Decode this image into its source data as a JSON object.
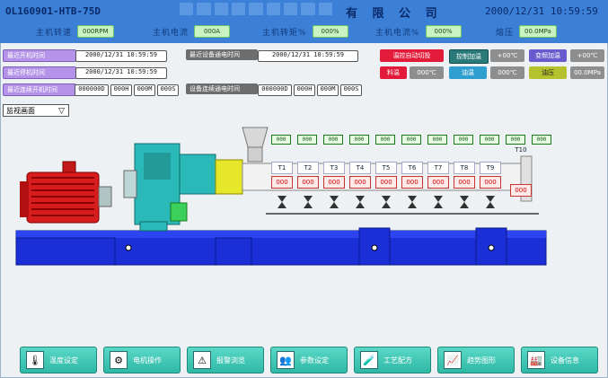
{
  "header": {
    "code": "OL160901-HTB-75D",
    "company": "有 限 公 司",
    "datetime": "2000/12/31 10:59:59",
    "stats": [
      {
        "label": "主机转速",
        "value": "000RPM"
      },
      {
        "label": "主机电流",
        "value": "000A"
      },
      {
        "label": "主机转矩%",
        "value": "000%"
      },
      {
        "label": "主机电流%",
        "value": "000%"
      },
      {
        "label": "熔压",
        "value": "00.0MPa"
      }
    ]
  },
  "info": {
    "last_start_label": "最近开机时间",
    "last_start_value": "2000/12/31 10:59:59",
    "last_power_label": "最近设备通电时间",
    "last_power_value": "2000/12/31 10:59:59",
    "last_stop_label": "最近停机时间",
    "last_stop_value": "2000/12/31 10:59:59",
    "cont_run_label": "最近连续开机时间",
    "cont_run_values": [
      "000000D",
      "000H",
      "000M",
      "000S"
    ],
    "cont_power_label": "设备连续通电时间",
    "cont_power_values": [
      "000000D",
      "000H",
      "000M",
      "000S"
    ]
  },
  "right_panel": {
    "auto_temp_label": "温控自动切投",
    "control_label": "控制加温",
    "control_value": "+00℃",
    "freq_label": "变频加温",
    "freq_value": "+00℃",
    "material_label": "料温",
    "material_value": "000℃",
    "oil_label": "油温",
    "oil_value": "000℃",
    "oil_pressure_label": "油压",
    "oil_pressure_value": "00.0MPa"
  },
  "view_select": {
    "selected": "监视画面",
    "arrow": "▽"
  },
  "zones": {
    "top_values": [
      "000",
      "000",
      "000",
      "000",
      "000",
      "000",
      "000",
      "000",
      "000",
      "000",
      "000"
    ],
    "labels": [
      "T1",
      "T2",
      "T3",
      "T4",
      "T5",
      "T6",
      "T7",
      "T8",
      "T9"
    ],
    "values": [
      "000",
      "000",
      "000",
      "000",
      "000",
      "000",
      "000",
      "000",
      "000"
    ],
    "t10_label": "T10",
    "t10_value": "000"
  },
  "nav": [
    {
      "label": "温度设定",
      "icon": "thermometer-icon",
      "glyph": "🌡"
    },
    {
      "label": "电机操作",
      "icon": "motor-icon",
      "glyph": "⚙"
    },
    {
      "label": "报警浏览",
      "icon": "warning-icon",
      "glyph": "⚠"
    },
    {
      "label": "参数设定",
      "icon": "people-icon",
      "glyph": "👥"
    },
    {
      "label": "工艺配方",
      "icon": "recipe-icon",
      "glyph": "🧪"
    },
    {
      "label": "趋势图形",
      "icon": "trend-chart-icon",
      "glyph": "📈"
    },
    {
      "label": "设备信息",
      "icon": "device-info-icon",
      "glyph": "🏭"
    }
  ],
  "colors": {
    "header_blue": "#3b7fd6",
    "accent_teal": "#2fb8a6",
    "alarm_red": "#e21b3a",
    "motor_red": "#d61c1c",
    "machine_cyan": "#2bb8b8",
    "base_blue": "#1a2fd6"
  }
}
